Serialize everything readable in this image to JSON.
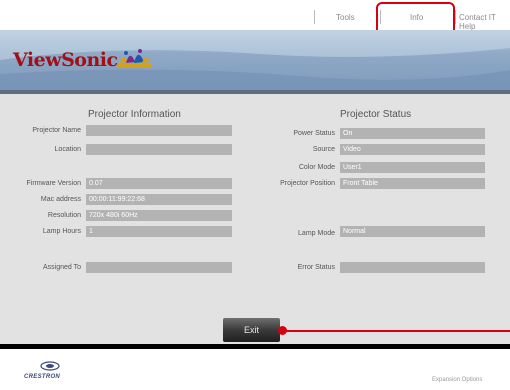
{
  "nav": {
    "tools_label": "Tools",
    "info_label": "Info",
    "contact_label": "Contact IT Help"
  },
  "brand": {
    "name": "ViewSonic"
  },
  "info": {
    "title": "Projector Information",
    "fields": [
      {
        "label": "Projector Name",
        "value": ""
      },
      {
        "label": "Location",
        "value": ""
      },
      {
        "label": "Firmware Version",
        "value": "0.07"
      },
      {
        "label": "Mac address",
        "value": "00:00:11:99:22:68"
      },
      {
        "label": "Resolution",
        "value": "720x 480i 60Hz"
      },
      {
        "label": "Lamp Hours",
        "value": "1"
      },
      {
        "label": "Assigned To",
        "value": ""
      }
    ]
  },
  "status": {
    "title": "Projector Status",
    "fields": [
      {
        "label": "Power Status",
        "value": "On"
      },
      {
        "label": "Source",
        "value": "Video"
      },
      {
        "label": "Color Mode",
        "value": "User1"
      },
      {
        "label": "Projector Position",
        "value": "Front Table"
      },
      {
        "label": "Lamp Mode",
        "value": "Normal"
      },
      {
        "label": "Error Status",
        "value": ""
      }
    ]
  },
  "actions": {
    "exit_label": "Exit"
  },
  "footer": {
    "crestron_label": "CRESTRON",
    "expansion_label": "Expansion Options"
  },
  "colors": {
    "highlight": "#d9000d",
    "brand_red": "#a01016",
    "field_bg": "#b3b3b3"
  }
}
